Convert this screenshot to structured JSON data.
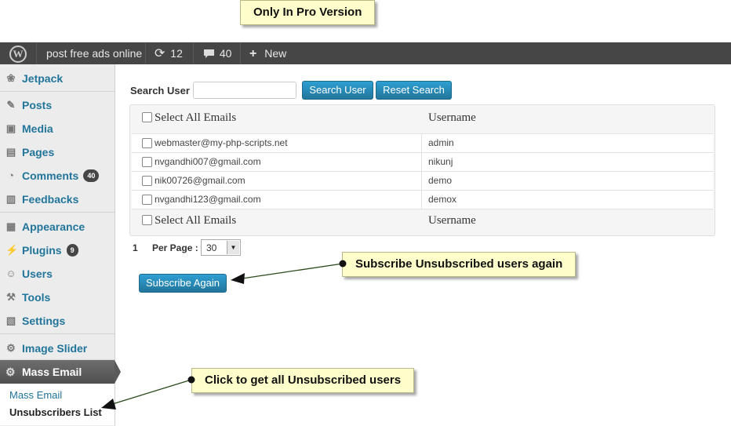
{
  "notes": {
    "pro_version": "Only In Pro Version",
    "subscribe_again": "Subscribe Unsubscribed users again",
    "unsubscribers": "Click to get all Unsubscribed users"
  },
  "adminbar": {
    "site_name": "post free ads online",
    "updates_count": "12",
    "comments_count": "40",
    "new_label": "New",
    "icons": [
      "wordpress-logo",
      "refresh-icon",
      "comment-bubble-icon",
      "plus-icon"
    ]
  },
  "sidebar": {
    "items": [
      {
        "label": "Jetpack",
        "icon": "jetpack-icon"
      },
      {
        "label": "Posts",
        "icon": "pin-icon"
      },
      {
        "label": "Media",
        "icon": "media-icon"
      },
      {
        "label": "Pages",
        "icon": "pages-icon"
      },
      {
        "label": "Comments",
        "icon": "comments-icon",
        "badge": "40"
      },
      {
        "label": "Feedbacks",
        "icon": "feedback-icon"
      },
      {
        "label": "Appearance",
        "icon": "appearance-icon"
      },
      {
        "label": "Plugins",
        "icon": "plugins-icon",
        "badge": "9"
      },
      {
        "label": "Users",
        "icon": "users-icon"
      },
      {
        "label": "Tools",
        "icon": "tools-icon"
      },
      {
        "label": "Settings",
        "icon": "settings-icon"
      },
      {
        "label": "Image Slider",
        "icon": "gear-icon"
      }
    ],
    "active": {
      "label": "Mass Email",
      "icon": "gear-icon"
    },
    "submenu": [
      {
        "label": "Mass Email"
      },
      {
        "label": "Unsubscribers List"
      }
    ]
  },
  "search": {
    "label": "Search User :",
    "value": "",
    "search_button": "Search User",
    "reset_button": "Reset Search"
  },
  "table": {
    "header_select_all": "Select All Emails",
    "header_username": "Username",
    "rows": [
      {
        "email": "webmaster@my-php-scripts.net",
        "username": "admin"
      },
      {
        "email": "nvgandhi007@gmail.com",
        "username": "nikunj"
      },
      {
        "email": "nik00726@gmail.com",
        "username": "demo"
      },
      {
        "email": "nvgandhi123@gmail.com",
        "username": "demox"
      }
    ]
  },
  "pagination": {
    "page": "1",
    "per_page_label": "Per Page :",
    "per_page_value": "30"
  },
  "actions": {
    "subscribe_again": "Subscribe Again"
  },
  "colors": {
    "accent": "#21759b",
    "admin_bar": "#464646",
    "note_bg": "#ffffcc"
  }
}
